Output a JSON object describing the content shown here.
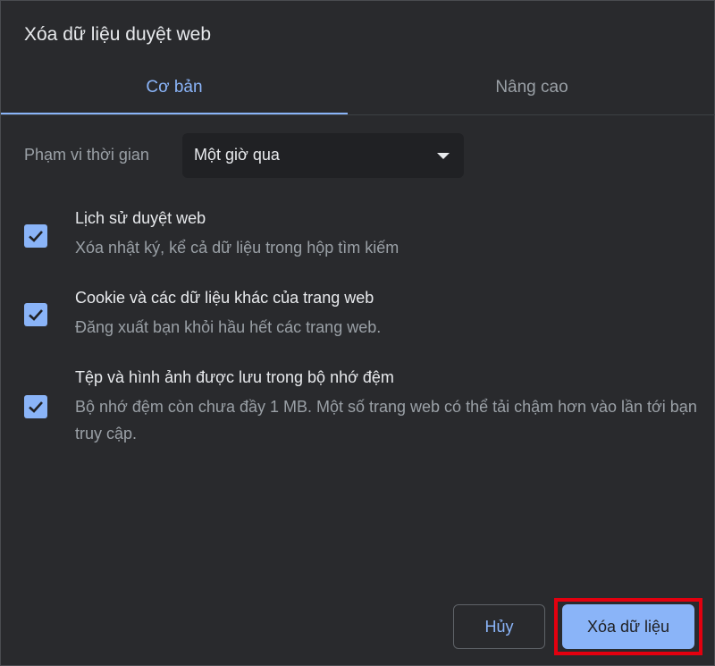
{
  "dialog": {
    "title": "Xóa dữ liệu duyệt web"
  },
  "tabs": [
    {
      "label": "Cơ bản",
      "active": true
    },
    {
      "label": "Nâng cao",
      "active": false
    }
  ],
  "time_range": {
    "label": "Phạm vi thời gian",
    "selected": "Một giờ qua"
  },
  "options": [
    {
      "title": "Lịch sử duyệt web",
      "desc": "Xóa nhật ký, kể cả dữ liệu trong hộp tìm kiếm",
      "checked": true
    },
    {
      "title": "Cookie và các dữ liệu khác của trang web",
      "desc": "Đăng xuất bạn khỏi hầu hết các trang web.",
      "checked": true
    },
    {
      "title": "Tệp và hình ảnh được lưu trong bộ nhớ đệm",
      "desc": "Bộ nhớ đệm còn chưa đầy 1 MB. Một số trang web có thể tải chậm hơn vào lần tới bạn truy cập.",
      "checked": true
    }
  ],
  "buttons": {
    "cancel": "Hủy",
    "clear": "Xóa dữ liệu"
  },
  "colors": {
    "accent": "#8ab4f8",
    "background": "#292a2d",
    "highlight": "#e3000f"
  }
}
